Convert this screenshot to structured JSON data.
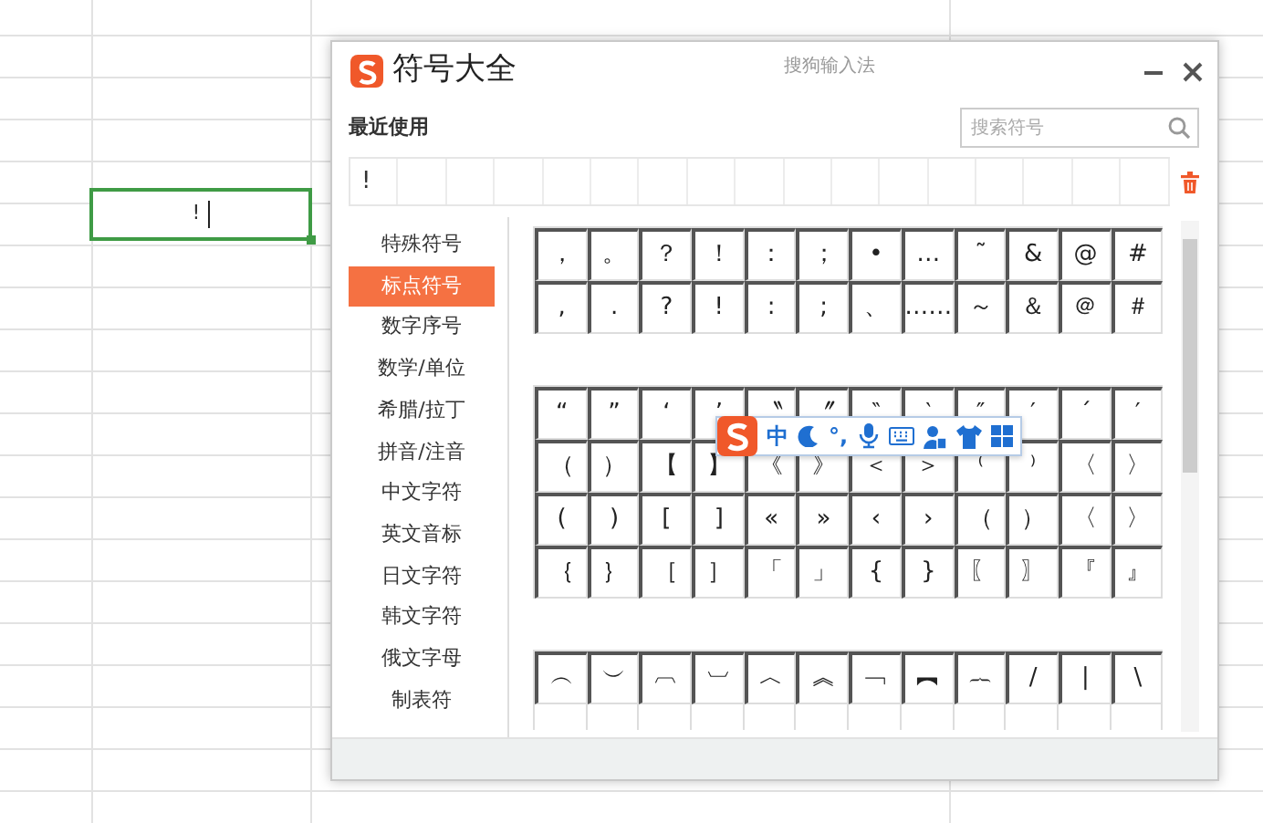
{
  "sheet": {
    "active_cell": {
      "value": "!"
    }
  },
  "dialog": {
    "title": "符号大全",
    "app_name": "搜狗输入法",
    "recent": {
      "label": "最近使用",
      "items": [
        "!"
      ]
    },
    "search": {
      "placeholder": "搜索符号"
    },
    "categories": [
      {
        "label": "特殊符号",
        "selected": false
      },
      {
        "label": "标点符号",
        "selected": true
      },
      {
        "label": "数字序号",
        "selected": false
      },
      {
        "label": "数学/单位",
        "selected": false
      },
      {
        "label": "希腊/拉丁",
        "selected": false
      },
      {
        "label": "拼音/注音",
        "selected": false
      },
      {
        "label": "中文字符",
        "selected": false
      },
      {
        "label": "英文音标",
        "selected": false
      },
      {
        "label": "日文字符",
        "selected": false
      },
      {
        "label": "韩文字符",
        "selected": false
      },
      {
        "label": "俄文字母",
        "selected": false
      },
      {
        "label": "制表符",
        "selected": false
      }
    ],
    "sections": [
      {
        "rows": [
          [
            "，",
            "。",
            "？",
            "！",
            "：",
            "；",
            "•",
            "…",
            "˜",
            "&",
            "@",
            "#"
          ],
          [
            ",",
            ".",
            "?",
            "!",
            ":",
            ";",
            "、",
            "……",
            "～",
            "＆",
            "＠",
            "＃"
          ]
        ]
      },
      {
        "rows": [
          [
            "“",
            "”",
            "‘",
            "’",
            "〝",
            "〞",
            "‶",
            "‵",
            "″",
            "′",
            "ˊ",
            "′"
          ],
          [
            "（",
            "）",
            "【",
            "】",
            "《",
            "》",
            "＜",
            "＞",
            "⁽",
            "⁾",
            "〈",
            "〉"
          ],
          [
            "(",
            ")",
            "[",
            "]",
            "«",
            "»",
            "‹",
            "›",
            "（",
            "）",
            "〈",
            "〉"
          ],
          [
            "｛",
            "｝",
            "［",
            "］",
            "「",
            "」",
            "{",
            "}",
            "〖",
            "〗",
            "『",
            "』"
          ]
        ]
      },
      {
        "rows": [
          [
            "︵",
            "︶",
            "︹",
            "︺",
            "︿",
            "︽",
            "﹁",
            "︻",
            "︷",
            "/",
            "|",
            "\\"
          ]
        ]
      }
    ],
    "ime_toolbar": {
      "mode": "中",
      "punctuation": "°,"
    }
  }
}
